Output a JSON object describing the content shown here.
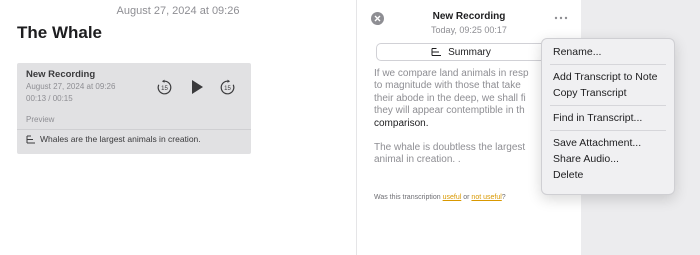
{
  "note": {
    "date": "August 27, 2024 at 09:26",
    "title": "The Whale"
  },
  "recording_card": {
    "name": "New Recording",
    "date": "August 27, 2024 at 09:26",
    "time": "00:13 / 00:15",
    "preview_label": "Preview",
    "summary_text": "Whales are the largest animals in creation.",
    "skip_back_seconds": "15",
    "skip_forward_seconds": "15"
  },
  "panel": {
    "title": "New Recording",
    "subtitle": "Today, 09:25  00:17",
    "summary_button": "Summary",
    "transcript_lines_1": [
      "If we compare land animals in resp",
      "to magnitude with those that take",
      "their abode in the deep, we shall fi",
      "they will appear contemptible in th"
    ],
    "transcript_highlight": "comparison.",
    "transcript_lines_2": [
      "The whale is doubtless the largest",
      "animal in creation. ."
    ],
    "feedback": {
      "prefix": "Was this transcription ",
      "useful": "useful",
      "or": " or ",
      "not_useful": "not useful",
      "suffix": "?"
    }
  },
  "menu": {
    "items": [
      "Rename...",
      "Add Transcript to Note",
      "Copy Transcript",
      "Find in Transcript...",
      "Save Attachment...",
      "Share Audio...",
      "Delete"
    ]
  },
  "colors": {
    "accent_link": "#d99800",
    "card_bg": "#e1e1e3",
    "menu_bg": "#f0f0f2"
  }
}
